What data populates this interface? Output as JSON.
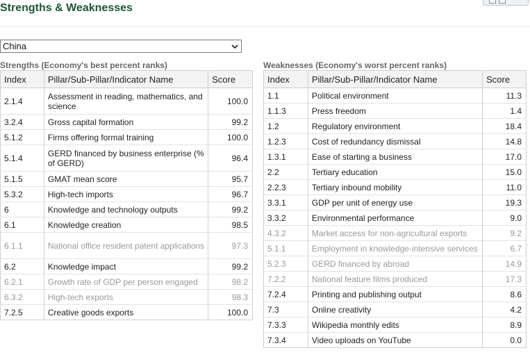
{
  "page_title": "Strengths & Weaknesses",
  "country_select": {
    "value": "China"
  },
  "strengths": {
    "caption": "Strengths (Economy's best percent ranks)",
    "headers": {
      "index": "Index",
      "name": "Pillar/Sub-Pillar/Indicator Name",
      "score": "Score"
    },
    "rows": [
      {
        "index": "2.1.4",
        "name": "Assessment in reading, mathematics, and science",
        "score": "100.0",
        "muted": false
      },
      {
        "index": "3.2.4",
        "name": "Gross capital formation",
        "score": "99.2",
        "muted": false
      },
      {
        "index": "5.1.2",
        "name": "Firms offering formal training",
        "score": "100.0",
        "muted": false
      },
      {
        "index": "5.1.4",
        "name": "GERD financed by business enterprise (% of GERD)",
        "score": "96.4",
        "muted": false
      },
      {
        "index": "5.1.5",
        "name": "GMAT mean score",
        "score": "95.7",
        "muted": false
      },
      {
        "index": "5.3.2",
        "name": "High-tech imports",
        "score": "96.7",
        "muted": false
      },
      {
        "index": "6",
        "name": "Knowledge and technology outputs",
        "score": "99.2",
        "muted": false
      },
      {
        "index": "6.1",
        "name": "Knowledge creation",
        "score": "98.5",
        "muted": false
      },
      {
        "index": "6.1.1",
        "name": "National office resident patent applications",
        "score": "97.3",
        "muted": true
      },
      {
        "index": "6.2",
        "name": "Knowledge impact",
        "score": "99.2",
        "muted": false
      },
      {
        "index": "6.2.1",
        "name": "Growth rate of GDP per person engaged",
        "score": "98.2",
        "muted": true
      },
      {
        "index": "6.3.2",
        "name": "High-tech exports",
        "score": "98.3",
        "muted": true
      },
      {
        "index": "7.2.5",
        "name": "Creative goods exports",
        "score": "100.0",
        "muted": false
      }
    ]
  },
  "weaknesses": {
    "caption": "Weaknesses (Economy's worst percent ranks)",
    "headers": {
      "index": "Index",
      "name": "Pillar/Sub-Pillar/Indicator Name",
      "score": "Score"
    },
    "rows": [
      {
        "index": "1.1",
        "name": "Political environment",
        "score": "11.3",
        "muted": false
      },
      {
        "index": "1.1.3",
        "name": "Press freedom",
        "score": "1.4",
        "muted": false
      },
      {
        "index": "1.2",
        "name": "Regulatory environment",
        "score": "18.4",
        "muted": false
      },
      {
        "index": "1.2.3",
        "name": "Cost of redundancy dismissal",
        "score": "14.8",
        "muted": false
      },
      {
        "index": "1.3.1",
        "name": "Ease of starting a business",
        "score": "17.0",
        "muted": false
      },
      {
        "index": "2.2",
        "name": "Tertiary education",
        "score": "15.0",
        "muted": false
      },
      {
        "index": "2.2.3",
        "name": "Tertiary inbound mobility",
        "score": "11.0",
        "muted": false
      },
      {
        "index": "3.3.1",
        "name": "GDP per unit of energy use",
        "score": "19.3",
        "muted": false
      },
      {
        "index": "3.3.2",
        "name": "Environmental performance",
        "score": "9.0",
        "muted": false
      },
      {
        "index": "4.3.2",
        "name": "Market access for non-agricultural exports",
        "score": "9.2",
        "muted": true
      },
      {
        "index": "5.1.1",
        "name": "Employment in knowledge-intensive services",
        "score": "6.7",
        "muted": true
      },
      {
        "index": "5.2.3",
        "name": "GERD financed by abroad",
        "score": "14.9",
        "muted": true
      },
      {
        "index": "7.2.2",
        "name": "National feature films produced",
        "score": "17.3",
        "muted": true
      },
      {
        "index": "7.2.4",
        "name": "Printing and publishing output",
        "score": "8.6",
        "muted": false
      },
      {
        "index": "7.3",
        "name": "Online creativity",
        "score": "4.2",
        "muted": false
      },
      {
        "index": "7.3.3",
        "name": "Wikipedia monthly edits",
        "score": "8.9",
        "muted": false
      },
      {
        "index": "7.3.4",
        "name": "Video uploads on YouTube",
        "score": "0.0",
        "muted": false
      }
    ]
  }
}
